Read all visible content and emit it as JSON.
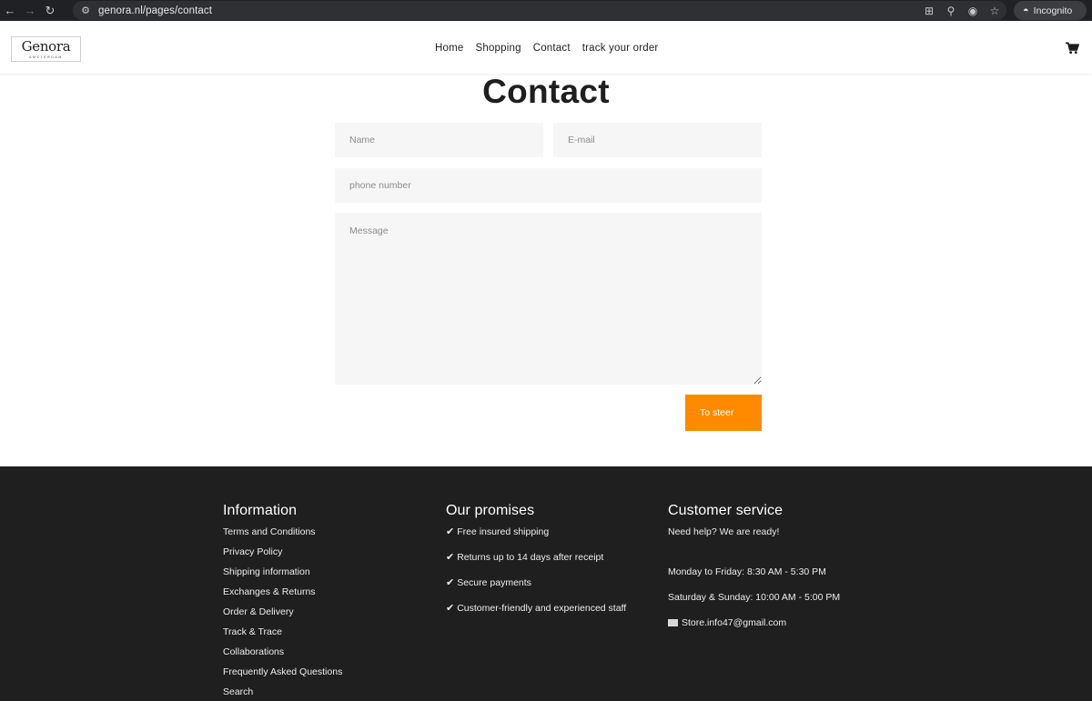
{
  "browser": {
    "url": "genora.nl/pages/contact",
    "profile_label": "Incognito"
  },
  "site": {
    "logo_text": "Genora",
    "logo_subtext": "AMSTERDAM",
    "nav": [
      {
        "label": "Home"
      },
      {
        "label": "Shopping"
      },
      {
        "label": "Contact"
      },
      {
        "label": "track your order"
      }
    ]
  },
  "contact": {
    "title": "Contact",
    "name_placeholder": "Name",
    "email_placeholder": "E-mail",
    "phone_placeholder": "phone number",
    "message_placeholder": "Message",
    "submit_label": "To steer"
  },
  "footer": {
    "info": {
      "heading": "Information",
      "links": [
        "Terms and Conditions",
        "Privacy Policy",
        "Shipping information",
        "Exchanges & Returns",
        "Order & Delivery",
        "Track & Trace",
        "Collaborations",
        "Frequently Asked Questions",
        "Search"
      ]
    },
    "promises": {
      "heading": "Our promises",
      "check": "✔",
      "items": [
        "Free insured shipping",
        "Returns up to 14 days after receipt",
        "Secure payments",
        "Customer-friendly and experienced staff"
      ]
    },
    "service": {
      "heading": "Customer service",
      "intro": "Need help? We are ready!",
      "weekday_hours": "Monday to Friday: 8:30 AM - 5:30 PM",
      "weekend_hours": "Saturday & Sunday: 10:00 AM - 5:00 PM",
      "email": "Store.info47@gmail.com"
    }
  },
  "colors": {
    "accent": "#ff8a00",
    "footer_bg": "#1f1f1f",
    "field_bg": "#f6f6f6"
  }
}
